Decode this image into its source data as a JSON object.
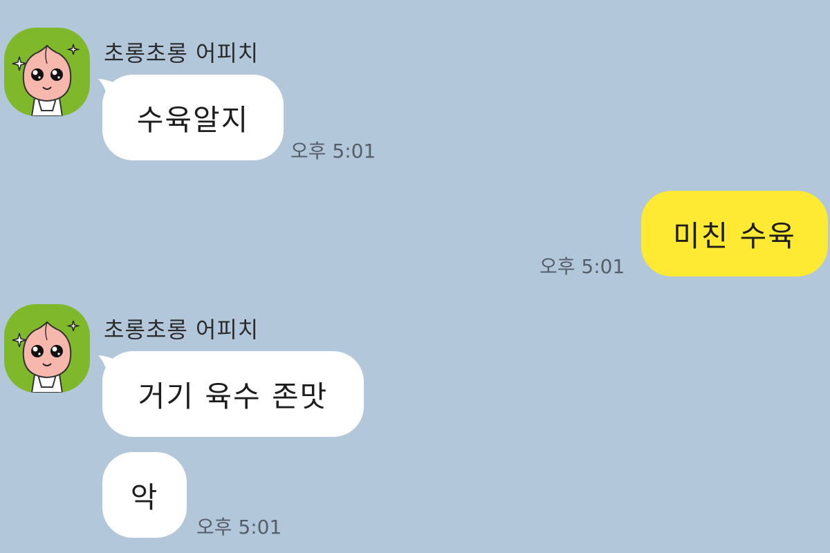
{
  "colors": {
    "background": "#b2c7da",
    "incoming_bubble": "#ffffff",
    "outgoing_bubble": "#fee933",
    "avatar_bg": "#7fb82a"
  },
  "messages": [
    {
      "direction": "incoming",
      "sender": "초롱초롱 어피치",
      "avatar_icon": "apeach-avatar-icon",
      "bubbles": [
        {
          "text": "수육알지",
          "time": "오후 5:01"
        }
      ]
    },
    {
      "direction": "outgoing",
      "bubbles": [
        {
          "text": "미친 수육",
          "time": "오후 5:01"
        }
      ]
    },
    {
      "direction": "incoming",
      "sender": "초롱초롱 어피치",
      "avatar_icon": "apeach-avatar-icon",
      "bubbles": [
        {
          "text": "거기 육수 존맛"
        },
        {
          "text": "악",
          "time": "오후 5:01"
        }
      ]
    }
  ]
}
